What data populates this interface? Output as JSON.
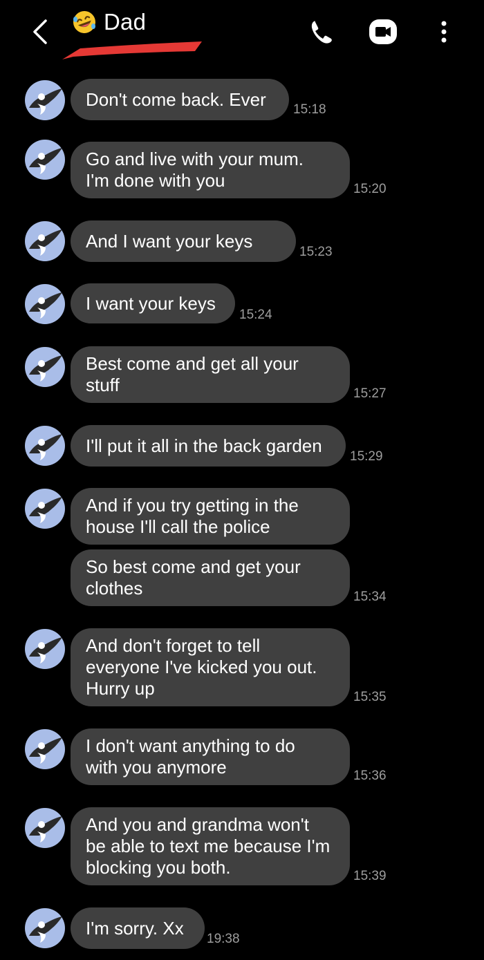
{
  "header": {
    "title": "Dad",
    "back_icon": "chevron-left-icon",
    "emoji_icon": "rolling-on-floor-laughing-emoji",
    "call_icon": "phone-icon",
    "video_icon": "video-camera-icon",
    "menu_icon": "more-vert-icon"
  },
  "colors": {
    "background": "#000000",
    "bubble": "#404040",
    "timestamp": "#9e9e9e",
    "avatar_bg": "#a9bde8",
    "redaction": "#e53935"
  },
  "messages": [
    {
      "text": "Don't come back.  Ever",
      "time": "15:18"
    },
    {
      "text": "Go and live with your mum.\nI'm done with you",
      "time": "15:20"
    },
    {
      "text": "And I want your keys",
      "time": "15:23"
    },
    {
      "text": "I want your keys",
      "time": "15:24"
    },
    {
      "text": "Best come and get all your\nstuff",
      "time": "15:27"
    },
    {
      "text": "I'll put it all in the back garden",
      "time": "15:29"
    },
    {
      "text": "And if you try getting in the\nhouse I'll call the police",
      "time": ""
    },
    {
      "text": "So best come and get your\nclothes",
      "time": "15:34"
    },
    {
      "text": "And don't forget to tell\neveryone I've kicked you out.\nHurry up",
      "time": "15:35"
    },
    {
      "text": "I don't want anything to do\nwith you anymore",
      "time": "15:36"
    },
    {
      "text": "And you and grandma won't\nbe able to text me because I'm\nblocking you both.",
      "time": "15:39"
    },
    {
      "text": "I'm sorry.  Xx",
      "time": "19:38"
    }
  ]
}
